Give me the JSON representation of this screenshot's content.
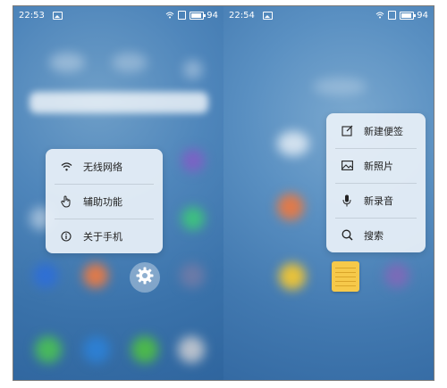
{
  "left_screen": {
    "status": {
      "time": "22:53",
      "battery": "94"
    },
    "menu": {
      "items": [
        {
          "label": "无线网络",
          "icon": "wifi-icon"
        },
        {
          "label": "辅助功能",
          "icon": "hand-pointer-icon"
        },
        {
          "label": "关于手机",
          "icon": "info-icon"
        }
      ]
    },
    "app_icon": "gear-icon"
  },
  "right_screen": {
    "status": {
      "time": "22:54",
      "battery": "94"
    },
    "menu": {
      "items": [
        {
          "label": "新建便签",
          "icon": "edit-note-icon"
        },
        {
          "label": "新照片",
          "icon": "photo-icon"
        },
        {
          "label": "新录音",
          "icon": "microphone-icon"
        },
        {
          "label": "搜索",
          "icon": "search-icon"
        }
      ]
    },
    "app_icon": "notes-icon"
  },
  "colors": {
    "menu_bg": "#e8f0f8",
    "notes_yellow": "#f6c94a",
    "wallpaper_blue": "#3a72aa"
  }
}
